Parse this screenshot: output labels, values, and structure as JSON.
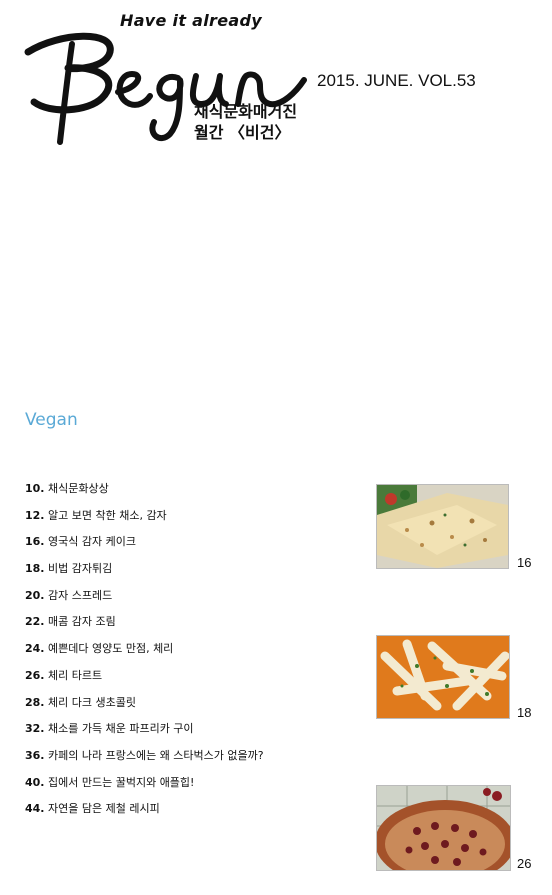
{
  "masthead": {
    "tagline": "Have it already",
    "logo": "Begun",
    "issue": "2015. JUNE. VOL.53",
    "title": "채식문화매거진",
    "subtitle": "월간 〈비건〉"
  },
  "section": {
    "title": "Vegan"
  },
  "toc": [
    {
      "num": "10.",
      "title": "채식문화상상"
    },
    {
      "num": "12.",
      "title": "알고 보면 착한 채소, 감자"
    },
    {
      "num": "16.",
      "title": "영국식 감자 케이크"
    },
    {
      "num": "18.",
      "title": "비법 감자튀김"
    },
    {
      "num": "20.",
      "title": "감자 스프레드"
    },
    {
      "num": "22.",
      "title": "매콤 감자 조림"
    },
    {
      "num": "24.",
      "title": "예쁜데다 영양도 만점, 체리"
    },
    {
      "num": "26.",
      "title": "체리 타르트"
    },
    {
      "num": "28.",
      "title": "체리 다크 생초콜릿"
    },
    {
      "num": "32.",
      "title": "채소를 가득 채운 파프리카 구이"
    },
    {
      "num": "36.",
      "title": "카페의 나라 프랑스에는 왜 스타벅스가 없을까?"
    },
    {
      "num": "40.",
      "title": "집에서 만드는 꿀벅지와 애플힙!"
    },
    {
      "num": "44.",
      "title": "자연을 담은 제철 레시피"
    }
  ],
  "photos": [
    {
      "icon": "potato-cake-photo",
      "page": "16"
    },
    {
      "icon": "potato-fries-photo",
      "page": "18"
    },
    {
      "icon": "cherry-tart-photo",
      "page": "26"
    }
  ]
}
